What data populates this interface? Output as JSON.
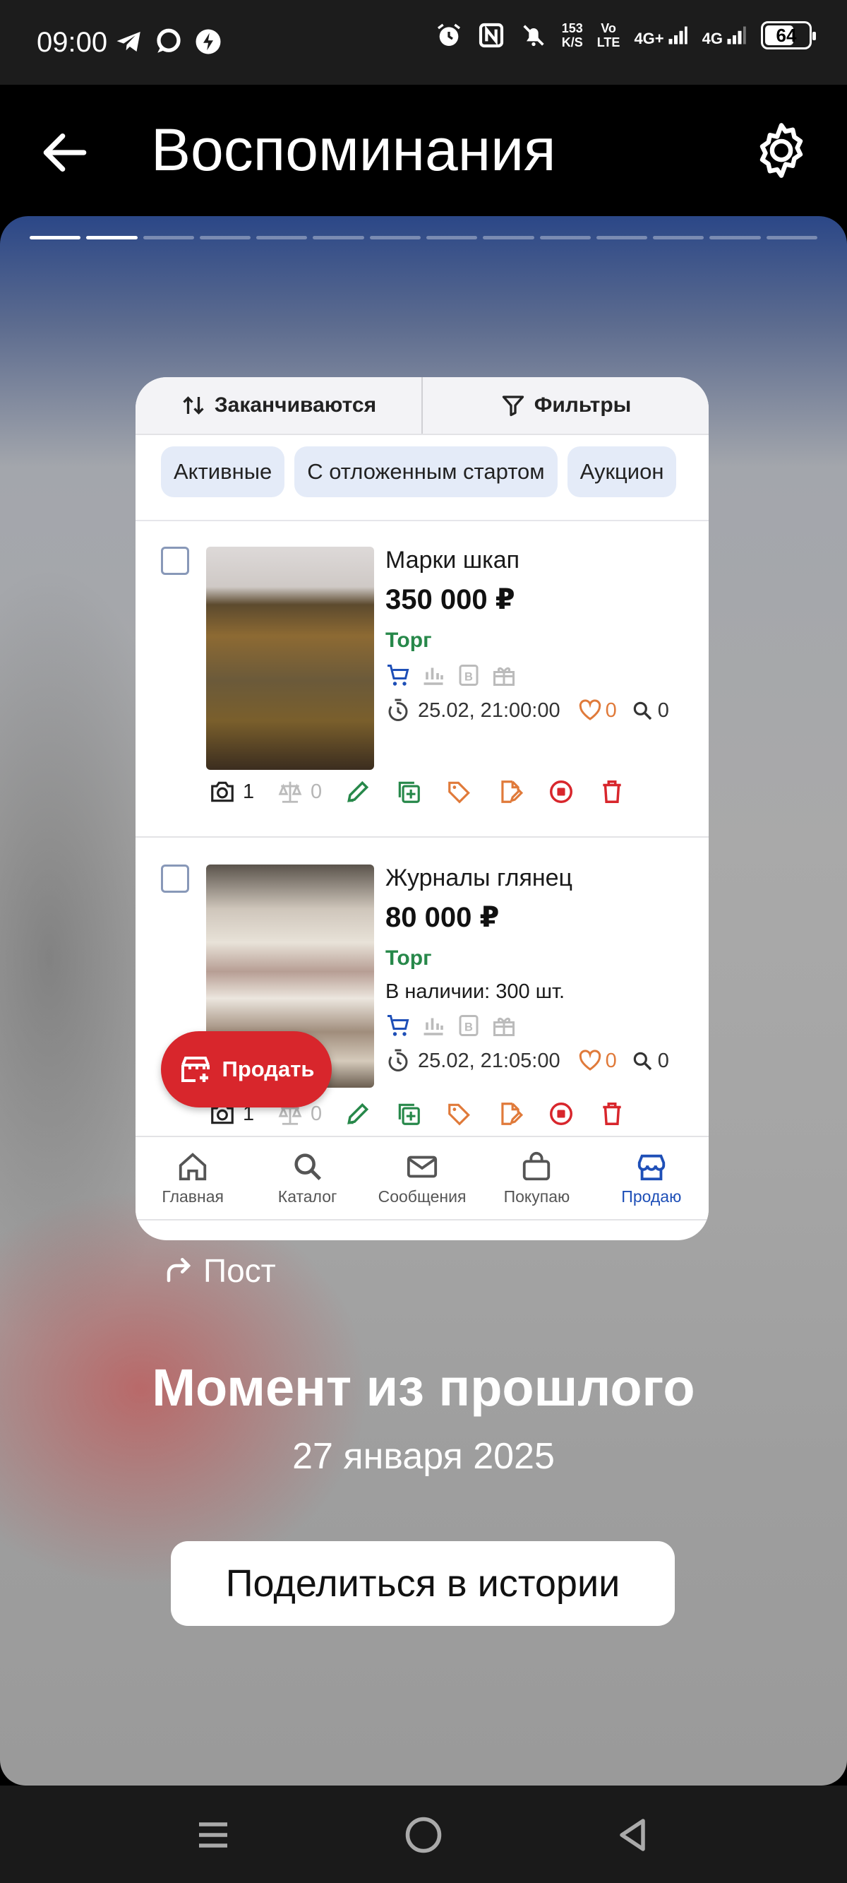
{
  "status_bar": {
    "time": "09:00",
    "net_speed_value": "153",
    "net_speed_unit": "K/S",
    "volte_top": "Vo",
    "volte_bottom": "LTE",
    "sim1_label": "4G+",
    "sim2_label": "4G",
    "battery": "64",
    "battery_level": 0.64,
    "icons": [
      "telegram-icon",
      "chat-icon",
      "shazam-icon",
      "alarm-icon",
      "nfc-icon",
      "mute-icon",
      "signal-icon",
      "battery-icon"
    ]
  },
  "app_bar": {
    "title": "Воспоминания",
    "icons": [
      "back-arrow-icon",
      "gear-icon"
    ]
  },
  "story": {
    "segments_total": 14,
    "segments_done": 2,
    "post_label": "Пост",
    "title": "Момент из прошлого",
    "date": "27 января 2025",
    "share_button": "Поделиться в истории"
  },
  "embedded": {
    "sort_label": "Заканчиваются",
    "filter_label": "Фильтры",
    "chips": [
      "Активные",
      "С отложенным стартом",
      "Аукцион"
    ],
    "listings": [
      {
        "title": "Марки шкап",
        "price": "350 000 ₽",
        "torg": "Торг",
        "stock": "",
        "ends": "25.02, 21:00:00",
        "likes": "0",
        "views": "0",
        "photos": "1",
        "compare": "0"
      },
      {
        "title": "Журналы глянец",
        "price": "80 000 ₽",
        "torg": "Торг",
        "stock": "В наличии: 300 шт.",
        "ends": "25.02, 21:05:00",
        "likes": "0",
        "views": "0",
        "photos": "1",
        "compare": "0"
      }
    ],
    "fab_label": "Продать",
    "nav": [
      {
        "label": "Главная",
        "icon": "home-icon"
      },
      {
        "label": "Каталог",
        "icon": "search-icon"
      },
      {
        "label": "Сообщения",
        "icon": "mail-icon"
      },
      {
        "label": "Покупаю",
        "icon": "bag-icon"
      },
      {
        "label": "Продаю",
        "icon": "store-icon",
        "active": true
      }
    ],
    "colors": {
      "accent_green": "#27884a",
      "accent_red": "#d8262c",
      "accent_orange": "#e07a3a",
      "nav_active": "#1e4fb7"
    }
  }
}
